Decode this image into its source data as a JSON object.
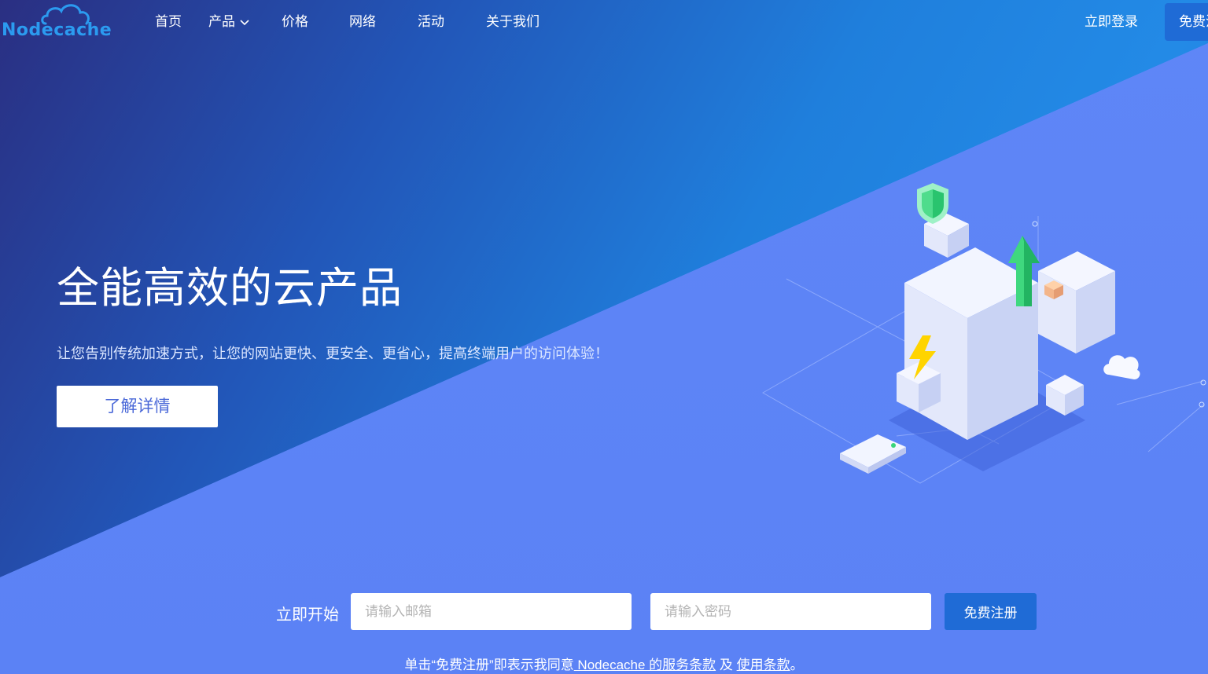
{
  "brand": {
    "logo_text": "Nodecache",
    "logo_color": "#2b9bf0"
  },
  "nav": {
    "items": [
      {
        "label": "首页"
      },
      {
        "label": "产品",
        "has_dropdown": true
      },
      {
        "label": "价格"
      },
      {
        "label": "网络"
      },
      {
        "label": "活动"
      },
      {
        "label": "关于我们"
      }
    ],
    "login_label": "立即登录",
    "signup_label": "免费注册"
  },
  "hero": {
    "title": "全能高效的云产品",
    "subtitle": "让您告别传统加速方式，让您的网站更快、更安全、更省心，提高终端用户的访问体验！",
    "cta_label": "了解详情"
  },
  "signup": {
    "label": "立即开始",
    "email_placeholder": "请输入邮箱",
    "email_value": "",
    "password_placeholder": "请输入密码",
    "password_value": "",
    "button_label": "免费注册"
  },
  "terms": {
    "prefix": "单击“免费注册”即表示我同意",
    "brand_link": " Nodecache 的服务条款",
    "middle": " 及 ",
    "usage_link": "使用条款",
    "suffix": "。"
  },
  "colors": {
    "accent": "#1f6bd6",
    "hero_dark": "#2256b8",
    "hero_light": "#5b85f6"
  }
}
